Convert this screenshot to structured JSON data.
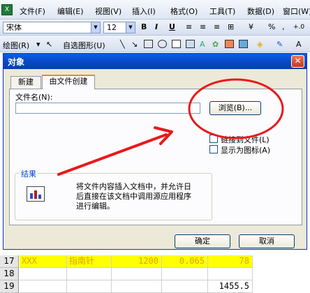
{
  "menu": {
    "items": [
      "文件(F)",
      "编辑(E)",
      "视图(V)",
      "插入(I)",
      "格式(O)",
      "工具(T)",
      "数据(D)",
      "窗口(W)"
    ]
  },
  "format_toolbar": {
    "font": "宋体",
    "size": "12",
    "bold": "B",
    "italic": "I",
    "underline": "U",
    "percent": "%"
  },
  "drawing_toolbar": {
    "draw_label": "绘图(R)",
    "autoshape_label": "自选图形(U)"
  },
  "dialog": {
    "title": "对象",
    "close": "✕",
    "tabs": [
      "新建",
      "由文件创建"
    ],
    "filename_label": "文件名(N):",
    "filename_value": "",
    "browse_label": "浏览(B)...",
    "link_label": "链接到文件(L)",
    "icon_label": "显示为图标(A)",
    "result_label": "结果",
    "result_text": "将文件内容插入文档中，并允许日后直接在该文档中调用源应用程序进行编辑。",
    "ok_label": "确定",
    "cancel_label": "取消"
  },
  "sheet": {
    "rows": [
      {
        "num": "17",
        "cells": [
          "XXX",
          "指南针",
          "1200",
          "0.065",
          "78"
        ]
      },
      {
        "num": "18",
        "cells": [
          "",
          "",
          "",
          "",
          ""
        ]
      },
      {
        "num": "19",
        "cells": [
          "",
          "",
          "",
          "",
          "1455.5"
        ]
      }
    ]
  },
  "colors": {
    "annotation": "#e8191b",
    "title_bar": "#0a5ee8",
    "highlight_cell": "#ffff00"
  }
}
